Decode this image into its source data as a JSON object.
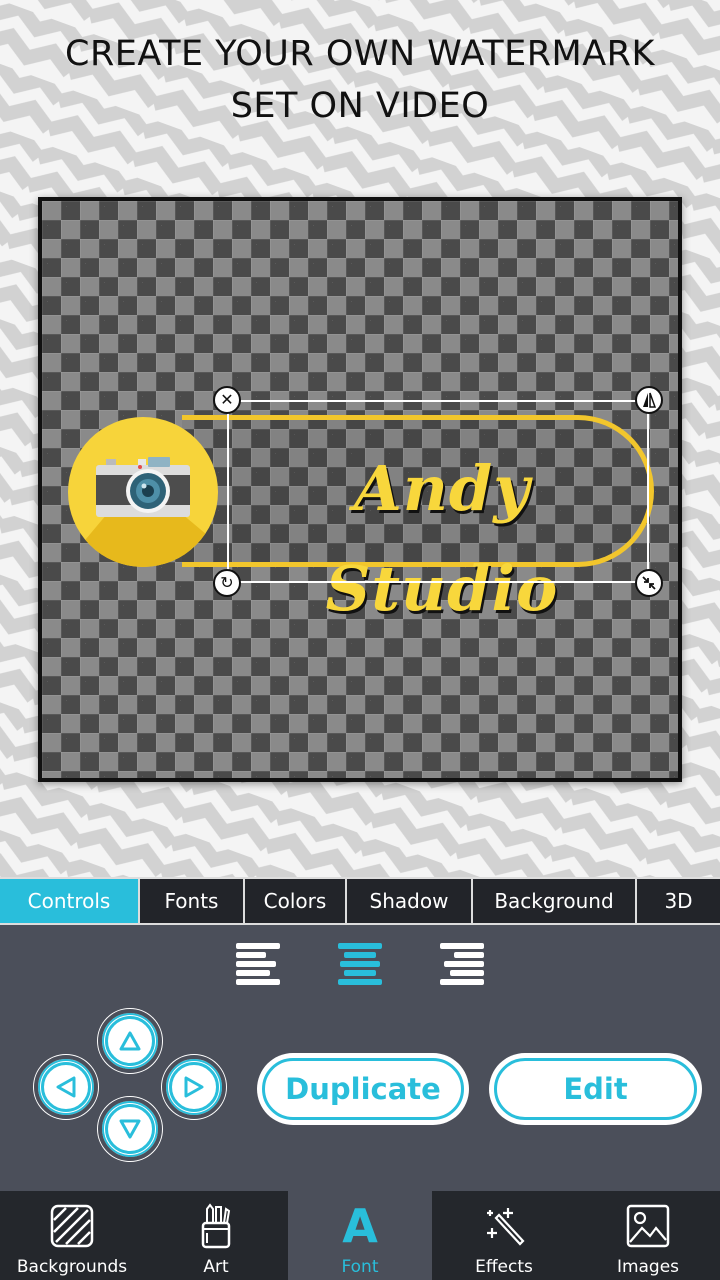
{
  "headline": {
    "line1": "CREATE YOUR OWN WATERMARK",
    "line2": "SET ON VIDEO"
  },
  "watermark": {
    "text": "Andy Studio",
    "icon": "camera-icon",
    "accent_color": "#f7d43a"
  },
  "selection_handles": {
    "delete": "close-icon",
    "flip": "flip-icon",
    "rotate": "rotate-icon",
    "resize": "resize-icon"
  },
  "tabs": [
    {
      "label": "Controls",
      "active": true
    },
    {
      "label": "Fonts",
      "active": false
    },
    {
      "label": "Colors",
      "active": false
    },
    {
      "label": "Shadow",
      "active": false
    },
    {
      "label": "Background",
      "active": false
    },
    {
      "label": "3D",
      "active": false
    }
  ],
  "alignment": {
    "options": [
      "align-left",
      "align-center",
      "align-right"
    ],
    "selected": "align-center"
  },
  "controls": {
    "dpad": [
      "up",
      "left",
      "right",
      "down"
    ],
    "duplicate_label": "Duplicate",
    "edit_label": "Edit"
  },
  "bottom_nav": [
    {
      "label": "Backgrounds",
      "icon": "backgrounds-icon",
      "active": false
    },
    {
      "label": "Art",
      "icon": "art-icon",
      "active": false
    },
    {
      "label": "Font",
      "icon": "font-icon",
      "active": true
    },
    {
      "label": "Effects",
      "icon": "magic-wand-icon",
      "active": false
    },
    {
      "label": "Images",
      "icon": "image-icon",
      "active": false
    }
  ],
  "colors": {
    "accent": "#29bedb",
    "panel": "#4b4f5a",
    "tab_bar": "#222429",
    "nav_bar": "#24272c"
  }
}
